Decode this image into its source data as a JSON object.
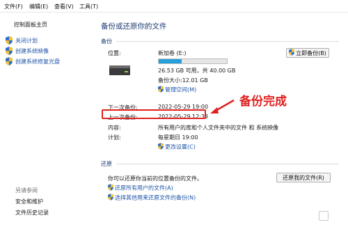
{
  "menu": {
    "file": "文件(F)",
    "edit": "编辑(E)",
    "view": "查看(V)",
    "tools": "工具(T)"
  },
  "sidebar": {
    "home": "控制面板主页",
    "tasks": [
      {
        "label": "关闭计划",
        "icon": "shield-icon"
      },
      {
        "label": "创建系统映像",
        "icon": "shield-icon"
      },
      {
        "label": "创建系统修复光盘",
        "icon": "shield-icon"
      }
    ],
    "see_also_title": "另请参阅",
    "see_also": [
      {
        "label": "安全和维护"
      },
      {
        "label": "文件历史记录"
      }
    ]
  },
  "main": {
    "title": "备份或还原你的文件",
    "backup": {
      "section": "备份",
      "location_label": "位置:",
      "drive_name": "新加卷 (E:)",
      "free_text": "26.53 GB 可用，共 40.00 GB",
      "used_fraction": 0.34,
      "backup_size": "备份大小:12.01 GB",
      "manage_space": "管理空间(M)",
      "backup_now": "立即备份(B)",
      "next_label": "下一次备份:",
      "next_value": "2022-05-29 19:00",
      "last_label": "上一次备份:",
      "last_value": "2022-05-29 12:33",
      "contents_label": "内容:",
      "contents_value": "所有用户的库和个人文件夹中的文件 和 系统映像",
      "schedule_label": "计划:",
      "schedule_value": "每星期日 19:00",
      "change_settings": "更改设置(C)"
    },
    "restore": {
      "section": "还原",
      "description": "你可以还原你当前的位置备份的文件。",
      "restore_my_files": "还原我的文件(R)",
      "restore_all_users": "还原所有用户的文件(A)",
      "select_other": "选择其他用来还原文件的备份(N)"
    }
  },
  "annotation": {
    "text": "备份完成",
    "color": "#e02020"
  },
  "colors": {
    "accent_link": "#1f55a8",
    "title": "#1e3b73",
    "progress": "#26a0da"
  }
}
